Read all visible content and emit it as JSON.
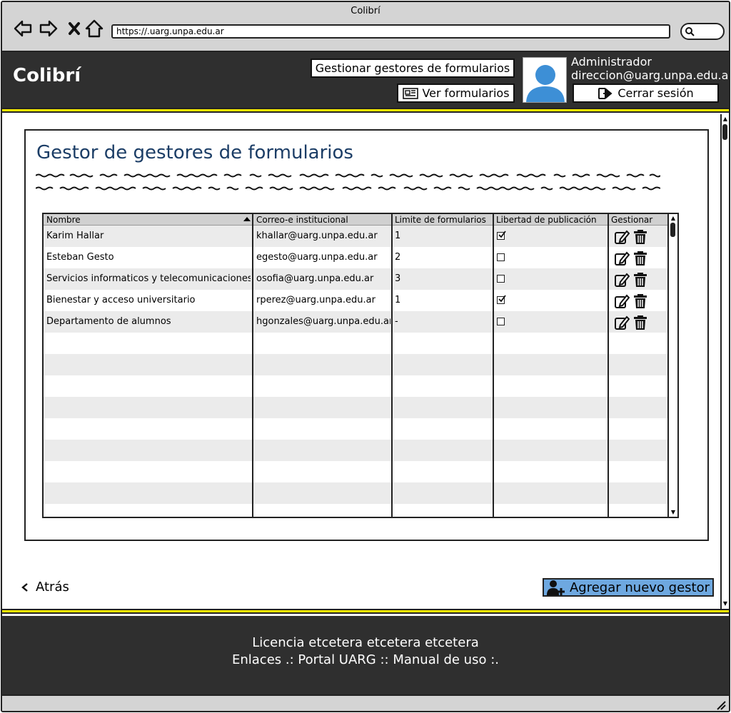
{
  "browser": {
    "window_title": "Colibrí",
    "url": "https://.uarg.unpa.edu.ar"
  },
  "header": {
    "brand": "Colibrí",
    "manage_button": "Gestionar gestores de formularios",
    "view_forms_button": "Ver formularios",
    "logout_button": "Cerrar sesión",
    "user_role": "Administrador",
    "user_email": "direccion@uarg.unpa.edu.ar"
  },
  "page": {
    "title": "Gestor de gestores de formularios",
    "back_label": "Atrás",
    "add_button": "Agregar nuevo gestor"
  },
  "table": {
    "columns": [
      "Nombre",
      "Correo-e institucional",
      "Limite de formularios",
      "Libertad de publicación",
      "Gestionar"
    ],
    "rows": [
      {
        "name": "Karim Hallar",
        "email": "khallar@uarg.unpa.edu.ar",
        "limit": "1",
        "free": true
      },
      {
        "name": "Esteban Gesto",
        "email": "egesto@uarg.unpa.edu.ar",
        "limit": "2",
        "free": false
      },
      {
        "name": "Servicios informaticos y telecomunicaciones",
        "email": "osofia@uarg.unpa.edu.ar",
        "limit": "3",
        "free": false
      },
      {
        "name": "Bienestar y acceso universitario",
        "email": "rperez@uarg.unpa.edu.ar",
        "limit": "1",
        "free": true
      },
      {
        "name": "Departamento de alumnos",
        "email": "hgonzales@uarg.unpa.edu.ar",
        "limit": "-",
        "free": false
      }
    ]
  },
  "footer": {
    "license": "Licencia etcetera etcetera etcetera",
    "links": "Enlaces .: Portal UARG :: Manual de uso :."
  },
  "colors": {
    "header_bg": "#2f2f2f",
    "accent_yellow": "#fff200",
    "title_blue": "#1b3d66",
    "add_button_bg": "#6ea8e0"
  },
  "icons": {
    "back": "arrow-left-icon",
    "forward": "arrow-right-icon",
    "stop": "close-icon",
    "home": "home-icon",
    "search": "search-icon",
    "forms": "newspaper-icon",
    "logout": "sign-out-icon",
    "edit": "edit-icon",
    "delete": "trash-icon",
    "add_user": "add-user-icon",
    "back_link": "chevron-left-icon"
  }
}
